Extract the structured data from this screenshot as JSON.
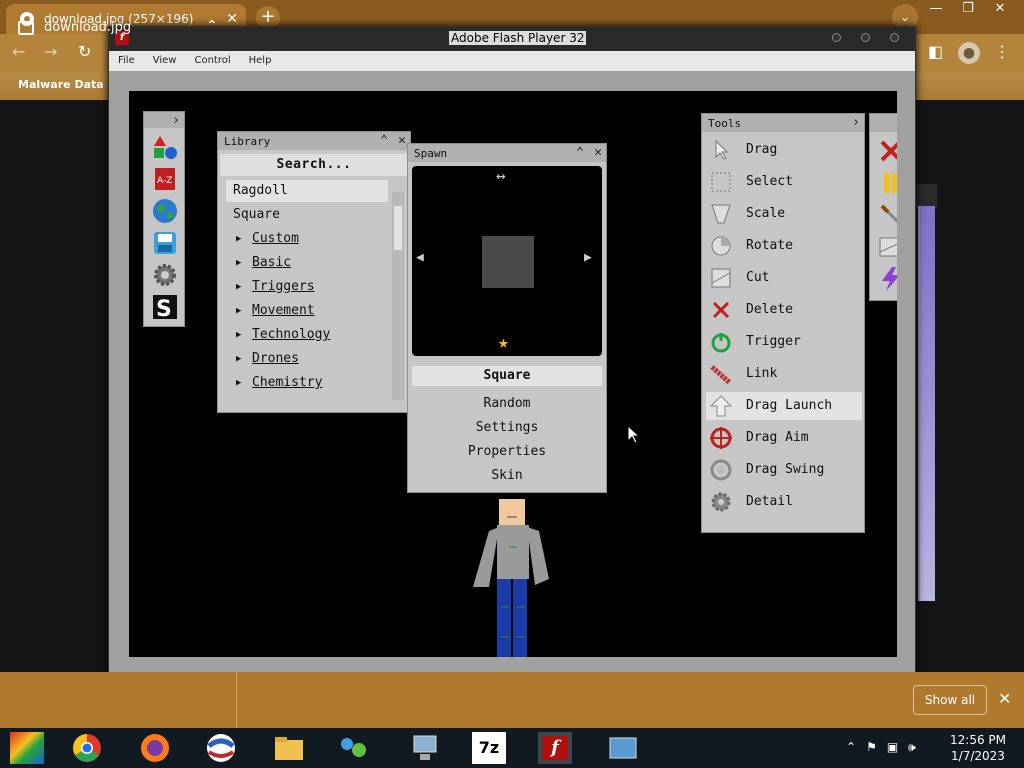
{
  "chrome": {
    "tab_title": "download.jpg (257×196)",
    "bookmark": "Malware Data"
  },
  "flash": {
    "title": "Adobe Flash Player 32",
    "menu": [
      "File",
      "View",
      "Control",
      "Help"
    ]
  },
  "library": {
    "title": "Library",
    "search": "Search...",
    "items": [
      "Ragdoll",
      "Square"
    ],
    "categories": [
      "Custom",
      "Basic",
      "Triggers",
      "Movement",
      "Technology",
      "Drones",
      "Chemistry"
    ]
  },
  "spawn": {
    "title": "Spawn",
    "buttons": [
      "Square",
      "Random",
      "Settings",
      "Properties",
      "Skin"
    ],
    "selected": "Square"
  },
  "tools": {
    "title": "Tools",
    "items": [
      "Drag",
      "Select",
      "Scale",
      "Rotate",
      "Cut",
      "Delete",
      "Trigger",
      "Link",
      "Drag Launch",
      "Drag Aim",
      "Drag Swing",
      "Detail"
    ],
    "active": "Drag Launch"
  },
  "downloads": {
    "file": "download.jpg",
    "show_all": "Show all"
  },
  "clock": {
    "time": "12:56 PM",
    "date": "1/7/2023"
  },
  "colors": {
    "chrome_frame": "#8a5a1e",
    "panel_bg": "#c6c6c6",
    "stage_bg": "#000000"
  }
}
